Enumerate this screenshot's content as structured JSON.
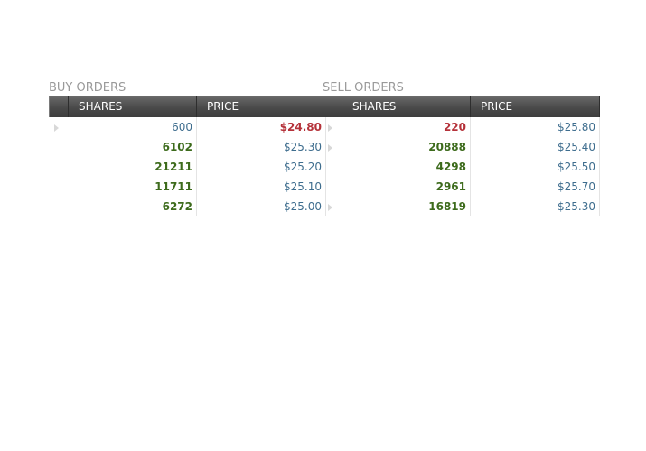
{
  "buy_orders": {
    "title": "BUY ORDERS",
    "columns": {
      "shares": "SHARES",
      "price": "PRICE"
    },
    "rows": [
      {
        "shares": "600",
        "price": "$24.80",
        "shares_style": "c-blue",
        "price_style": "c-red",
        "arrow": true
      },
      {
        "shares": "6102",
        "price": "$25.30",
        "shares_style": "c-green",
        "price_style": "c-blue",
        "arrow": false
      },
      {
        "shares": "21211",
        "price": "$25.20",
        "shares_style": "c-green",
        "price_style": "c-blue",
        "arrow": false
      },
      {
        "shares": "11711",
        "price": "$25.10",
        "shares_style": "c-green",
        "price_style": "c-blue",
        "arrow": false
      },
      {
        "shares": "6272",
        "price": "$25.00",
        "shares_style": "c-green",
        "price_style": "c-blue",
        "arrow": false
      }
    ]
  },
  "sell_orders": {
    "title": "SELL ORDERS",
    "columns": {
      "shares": "SHARES",
      "price": "PRICE"
    },
    "rows": [
      {
        "shares": "220",
        "price": "$25.80",
        "shares_style": "c-red",
        "price_style": "c-blue",
        "arrow": true
      },
      {
        "shares": "20888",
        "price": "$25.40",
        "shares_style": "c-green",
        "price_style": "c-blue",
        "arrow": true
      },
      {
        "shares": "4298",
        "price": "$25.50",
        "shares_style": "c-green",
        "price_style": "c-blue",
        "arrow": false
      },
      {
        "shares": "2961",
        "price": "$25.70",
        "shares_style": "c-green",
        "price_style": "c-blue",
        "arrow": false
      },
      {
        "shares": "16819",
        "price": "$25.30",
        "shares_style": "c-green",
        "price_style": "c-blue",
        "arrow": true
      }
    ]
  },
  "colors": {
    "header_bg": "#4a4a4a",
    "title_text": "#9a9a9a",
    "value_blue": "#3e6d8e",
    "value_green": "#3d6b1c",
    "value_red": "#b5323a"
  },
  "icons": {
    "row_indicator": "row-indicator-arrow-icon"
  }
}
